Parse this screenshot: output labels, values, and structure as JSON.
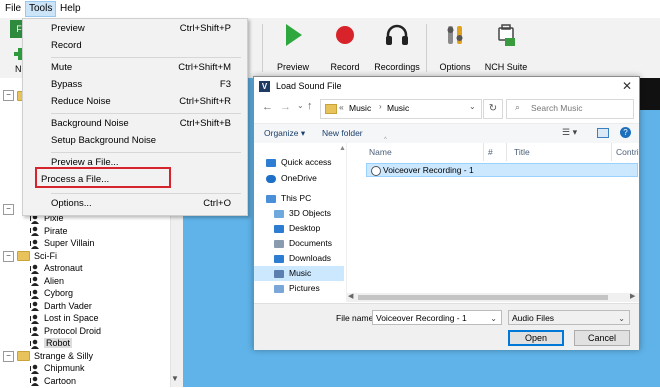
{
  "menubar": {
    "items": [
      "File",
      "Tools",
      "Help"
    ]
  },
  "toolbar": {
    "tab_fragment": "Fi",
    "partial_label": "N",
    "buttons": [
      {
        "label": "Preview",
        "icon": "play-icon"
      },
      {
        "label": "Record",
        "icon": "record-icon"
      },
      {
        "label": "Recordings",
        "icon": "headphones-icon"
      },
      {
        "label": "Options",
        "icon": "options-icon"
      },
      {
        "label": "NCH Suite",
        "icon": "nch-suite-icon"
      }
    ]
  },
  "tools_menu": {
    "items": [
      {
        "label": "Preview",
        "shortcut": "Ctrl+Shift+P"
      },
      {
        "label": "Record",
        "shortcut": ""
      },
      {
        "label": "Mute",
        "shortcut": "Ctrl+Shift+M"
      },
      {
        "label": "Bypass",
        "shortcut": "F3"
      },
      {
        "label": "Reduce Noise",
        "shortcut": "Ctrl+Shift+R"
      },
      {
        "label": "Background Noise",
        "shortcut": "Ctrl+Shift+B"
      },
      {
        "label": "Setup Background Noise",
        "shortcut": ""
      },
      {
        "label": "Preview a File...",
        "shortcut": ""
      },
      {
        "label": "Process a File...",
        "shortcut": ""
      },
      {
        "label": "Options...",
        "shortcut": "Ctrl+O"
      }
    ]
  },
  "tree": {
    "items": [
      {
        "type": "voice",
        "label": "Pixie"
      },
      {
        "type": "voice",
        "label": "Pirate"
      },
      {
        "type": "voice",
        "label": "Super Villain"
      },
      {
        "type": "folder",
        "label": "Sci-Fi"
      },
      {
        "type": "voice",
        "label": "Astronaut"
      },
      {
        "type": "voice",
        "label": "Alien"
      },
      {
        "type": "voice",
        "label": "Cyborg"
      },
      {
        "type": "voice",
        "label": "Darth Vader"
      },
      {
        "type": "voice",
        "label": "Lost in Space"
      },
      {
        "type": "voice",
        "label": "Protocol Droid"
      },
      {
        "type": "voice",
        "label": "Robot"
      },
      {
        "type": "folder",
        "label": "Strange & Silly"
      },
      {
        "type": "voice",
        "label": "Chipmunk"
      },
      {
        "type": "voice",
        "label": "Cartoon"
      }
    ]
  },
  "dialog": {
    "title": "Load Sound File",
    "breadcrumb": [
      "Music",
      "Music"
    ],
    "breadcrumb_prefix": "«",
    "search_placeholder": "Search Music",
    "organize_label": "Organize",
    "new_folder_label": "New folder",
    "nav_items": [
      {
        "label": "Quick access",
        "icon": "star-icon"
      },
      {
        "label": "OneDrive",
        "icon": "cloud-icon"
      },
      {
        "label": "This PC",
        "icon": "computer-icon"
      },
      {
        "label": "3D Objects",
        "icon": "cube-icon"
      },
      {
        "label": "Desktop",
        "icon": "desktop-icon"
      },
      {
        "label": "Documents",
        "icon": "documents-icon"
      },
      {
        "label": "Downloads",
        "icon": "download-icon"
      },
      {
        "label": "Music",
        "icon": "music-icon",
        "selected": true
      },
      {
        "label": "Pictures",
        "icon": "pictures-icon"
      }
    ],
    "columns": [
      "Name",
      "#",
      "Title",
      "Contri"
    ],
    "files": [
      "Voiceover Recording - 1"
    ],
    "filename_label": "File name:",
    "filename_value": "Voiceover Recording - 1",
    "filetype_value": "Audio Files",
    "open_label": "Open",
    "cancel_label": "Cancel"
  },
  "colors": {
    "workarea": "#5fb3e8",
    "highlight_box": "#d6242f",
    "selection": "#cce8ff"
  }
}
